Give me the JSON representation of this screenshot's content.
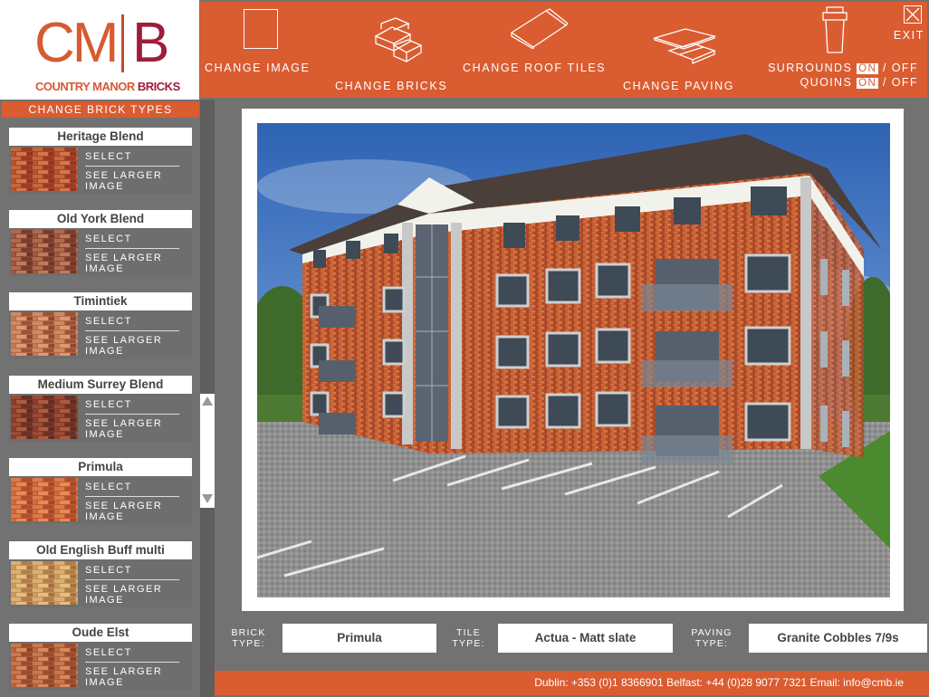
{
  "logo": {
    "mark_left": "CM",
    "mark_right": "B",
    "tagline_part1": "COUNTRY MANOR",
    "tagline_part2": "BRICKS"
  },
  "toolbar": {
    "change_image": "CHANGE IMAGE",
    "change_bricks": "CHANGE BRICKS",
    "change_roof_tiles": "CHANGE ROOF TILES",
    "change_paving": "CHANGE PAVING",
    "exit": "EXIT",
    "surrounds_label": "SURROUNDS",
    "quoins_label": "QUOINS",
    "on": "ON",
    "separator": "/",
    "off": "OFF"
  },
  "left_panel": {
    "header": "CHANGE BRICK TYPES",
    "select_label": "SELECT",
    "larger_label": "SEE LARGER IMAGE",
    "bricks": [
      {
        "name": "Heritage Blend"
      },
      {
        "name": "Old York Blend"
      },
      {
        "name": "Timintiek"
      },
      {
        "name": "Medium Surrey Blend"
      },
      {
        "name": "Primula"
      },
      {
        "name": "Old English Buff multi"
      },
      {
        "name": "Oude Elst"
      }
    ]
  },
  "info_bar": {
    "brick_label": "BRICK TYPE:",
    "brick_value": "Primula",
    "tile_label": "TILE TYPE:",
    "tile_value": "Actua - Matt slate",
    "paving_label": "PAVING TYPE:",
    "paving_value": "Granite Cobbles 7/9s"
  },
  "footer": {
    "contact": "Dublin: +353 (0)1 8366901 Belfast:  +44 (0)28 9077 7321  Email: info@cmb.ie"
  },
  "colors": {
    "accent": "#da5c31",
    "panel": "#727272",
    "brand_red": "#a01c3c"
  }
}
